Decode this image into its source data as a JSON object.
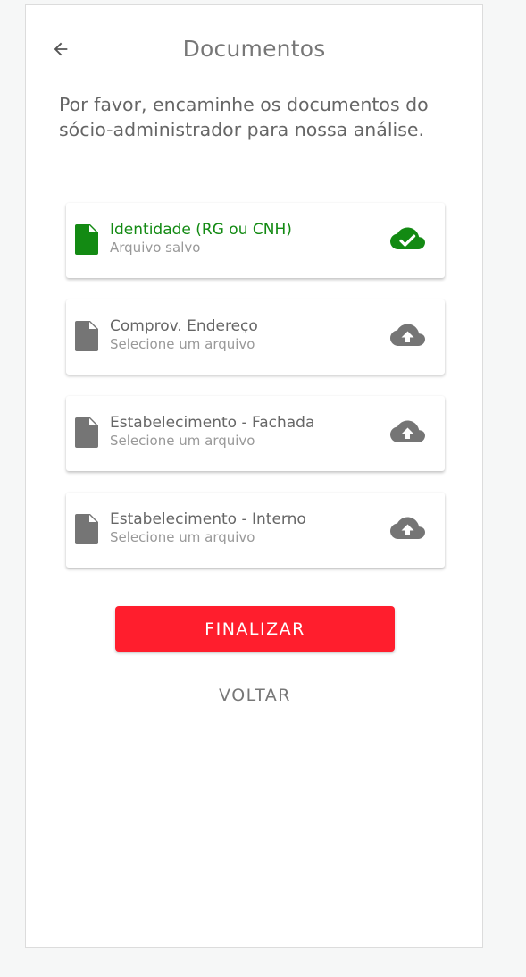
{
  "header": {
    "back_icon": "arrow-left-icon",
    "title": "Documentos"
  },
  "intro": "Por favor, encaminhe os documentos do sócio-administrador para nossa análise.",
  "documents": [
    {
      "name": "Identidade (RG ou CNH)",
      "status": "Arquivo salvo",
      "state": "saved",
      "file_icon": "file-icon",
      "action_icon": "cloud-check-icon"
    },
    {
      "name": "Comprov. Endereço",
      "status": "Selecione um arquivo",
      "state": "pending",
      "file_icon": "file-icon",
      "action_icon": "cloud-upload-icon"
    },
    {
      "name": "Estabelecimento - Fachada",
      "status": "Selecione um arquivo",
      "state": "pending",
      "file_icon": "file-icon",
      "action_icon": "cloud-upload-icon"
    },
    {
      "name": "Estabelecimento - Interno",
      "status": "Selecione um arquivo",
      "state": "pending",
      "file_icon": "file-icon",
      "action_icon": "cloud-upload-icon"
    }
  ],
  "actions": {
    "finalize_label": "FINALIZAR",
    "back_label": "VOLTAR"
  },
  "colors": {
    "saved": "#138a13",
    "pending": "#757575",
    "primary": "#ff1e2d"
  }
}
